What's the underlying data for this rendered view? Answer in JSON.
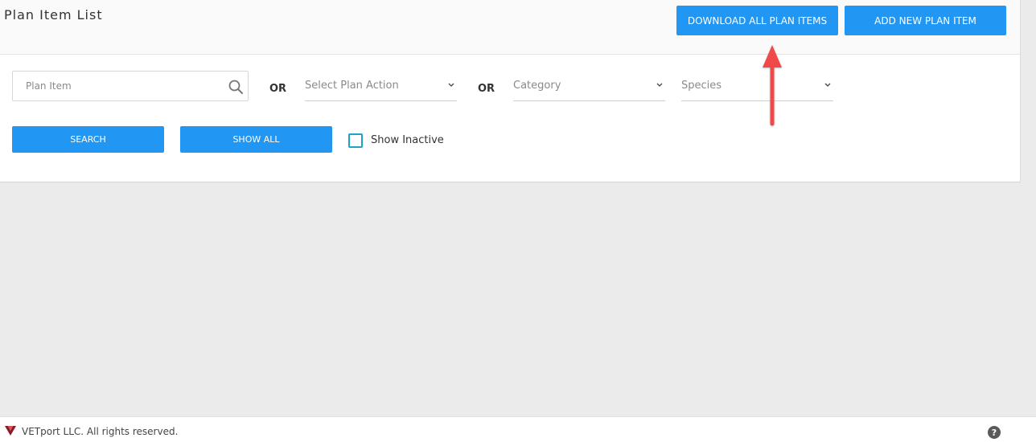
{
  "header": {
    "title": "Plan Item List",
    "download_label": "DOWNLOAD ALL PLAN ITEMS",
    "add_label": "ADD NEW PLAN ITEM"
  },
  "filters": {
    "plan_item_placeholder": "Plan Item",
    "or_label": "OR",
    "plan_action_placeholder": "Select Plan Action",
    "category_placeholder": "Category",
    "species_placeholder": "Species"
  },
  "actions": {
    "search_label": "SEARCH",
    "show_all_label": "SHOW ALL",
    "show_inactive_label": "Show Inactive",
    "show_inactive_checked": false
  },
  "footer": {
    "copyright": "VETport LLC. All rights reserved.",
    "help_icon": "question-circle-icon",
    "logo_icon": "vetport-logo-icon"
  },
  "colors": {
    "accent": "#2196f3",
    "checkbox_border": "#1fa3c4",
    "annotation_arrow": "#f04a4a"
  }
}
